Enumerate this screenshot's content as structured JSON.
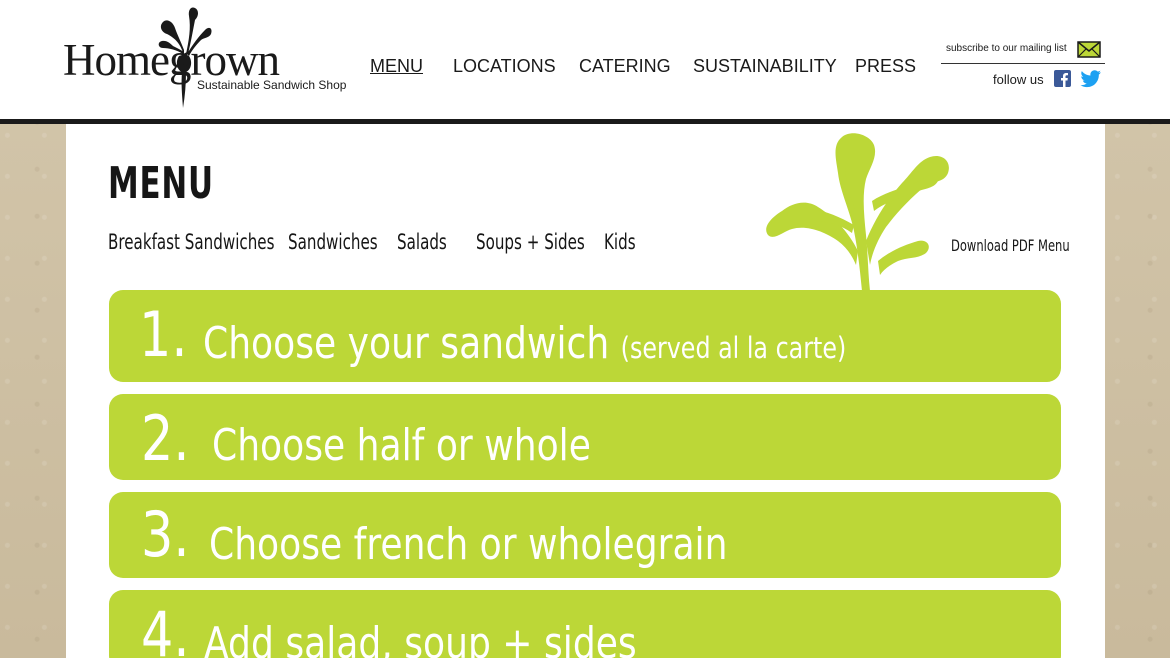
{
  "brand": {
    "name": "Homegrown",
    "tagline": "Sustainable Sandwich Shop"
  },
  "nav": {
    "items": [
      {
        "label": "MENU",
        "active": true
      },
      {
        "label": "LOCATIONS",
        "active": false
      },
      {
        "label": "CATERING",
        "active": false
      },
      {
        "label": "SUSTAINABILITY",
        "active": false
      },
      {
        "label": "PRESS",
        "active": false
      }
    ]
  },
  "utility": {
    "mailing_label": "subscribe to our mailing list",
    "follow_label": "follow us",
    "icons": [
      "envelope-icon",
      "facebook-icon",
      "twitter-icon"
    ]
  },
  "page": {
    "title": "MENU",
    "sub_nav": [
      "Breakfast Sandwiches",
      "Sandwiches",
      "Salads",
      "Soups + Sides",
      "Kids"
    ],
    "download_label": "Download PDF Menu"
  },
  "steps": [
    {
      "number": "1.",
      "text": "Choose your sandwich",
      "note": "(served al la carte)"
    },
    {
      "number": "2.",
      "text": "Choose half or whole",
      "note": ""
    },
    {
      "number": "3.",
      "text": "Choose french or wholegrain",
      "note": ""
    },
    {
      "number": "4.",
      "text": "Add salad, soup + sides",
      "note": ""
    }
  ],
  "colors": {
    "accent_green": "#bcd737",
    "header_bg": "#ffffff",
    "page_bg": "#cdbfa3",
    "facebook": "#3b5998",
    "twitter": "#1da1f2"
  }
}
